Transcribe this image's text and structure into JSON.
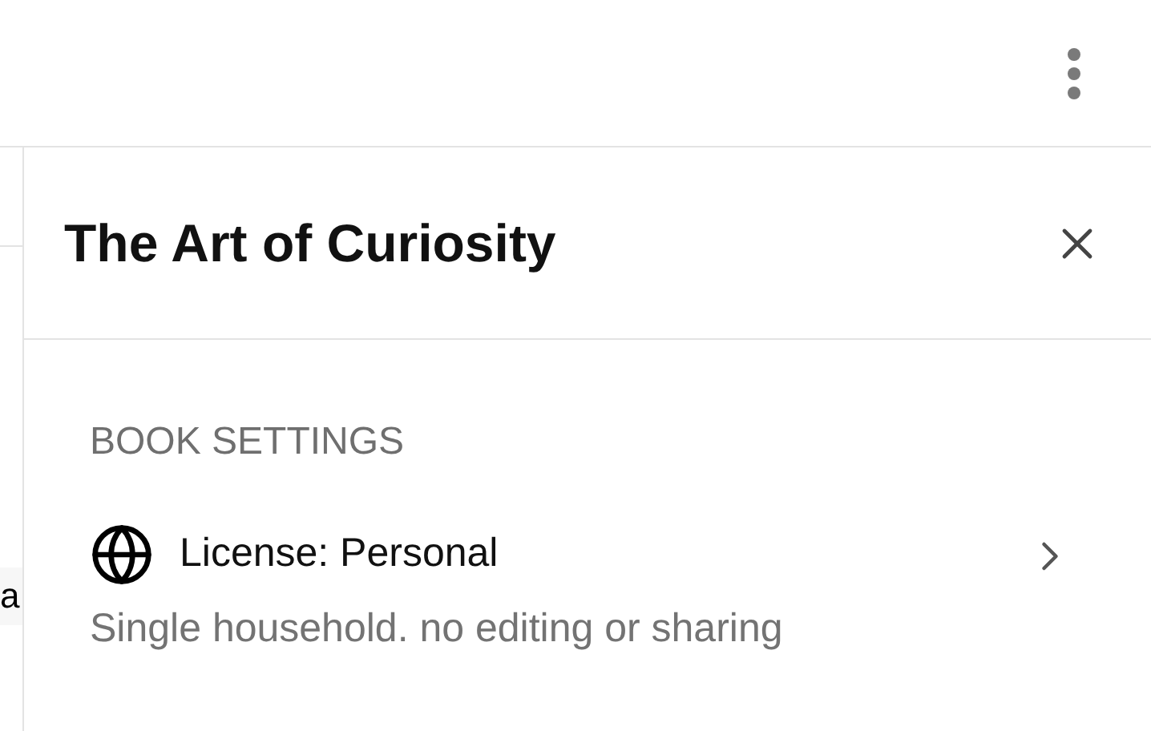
{
  "background_text": "a",
  "panel": {
    "title": "The Art of Curiosity",
    "section_heading": "BOOK SETTINGS",
    "settings": [
      {
        "kind": "link",
        "label": "License: Personal",
        "description": "Single household. no editing or sharing"
      }
    ]
  }
}
